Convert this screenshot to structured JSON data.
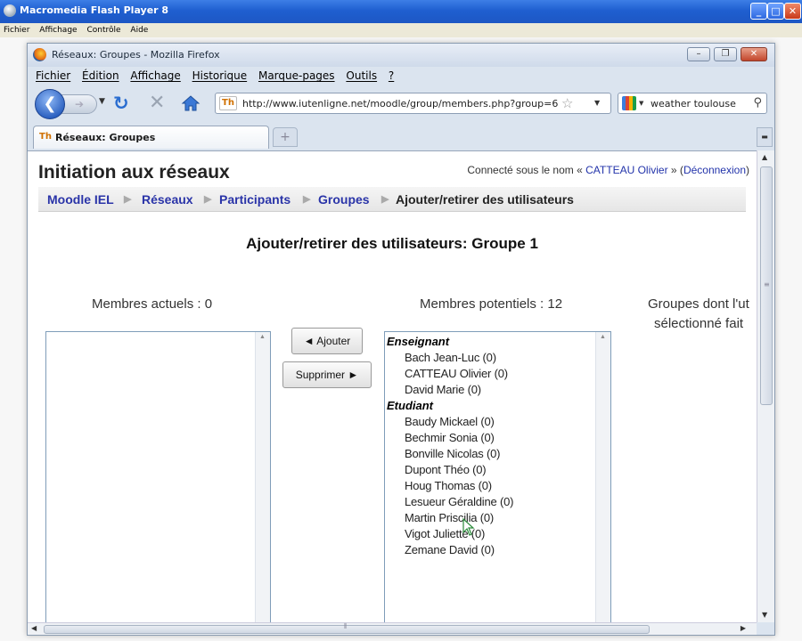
{
  "flash_player": {
    "title": "Macromedia Flash Player 8",
    "menu": [
      "Fichier",
      "Affichage",
      "Contrôle",
      "Aide"
    ]
  },
  "firefox": {
    "title": "Réseaux: Groupes - Mozilla Firefox",
    "menu": [
      "Fichier",
      "Édition",
      "Affichage",
      "Historique",
      "Marque-pages",
      "Outils",
      "?"
    ],
    "url": "http://www.iutenligne.net/moodle/group/members.php?group=6",
    "search_value": "weather toulouse",
    "tab_label": "Réseaux: Groupes",
    "tab_new": "+"
  },
  "page": {
    "course_title": "Initiation aux réseaux",
    "login_prefix": "Connecté sous le nom «",
    "login_user": "CATTEAU Olivier",
    "login_middle": "» (",
    "logout": "Déconnexion",
    "login_suffix": ")",
    "breadcrumb": [
      "Moodle IEL",
      "Réseaux",
      "Participants",
      "Groupes"
    ],
    "breadcrumb_current": "Ajouter/retirer des utilisateurs",
    "heading": "Ajouter/retirer des utilisateurs: Groupe 1",
    "current_members_label": "Membres actuels : 0",
    "potential_members_label": "Membres potentiels : 12",
    "groups_label_line1": "Groupes dont l'ut",
    "groups_label_line2": "sélectionné fait",
    "add_button": "◄ Ajouter",
    "remove_button": "Supprimer ►",
    "potential_members": [
      {
        "group": "Enseignant",
        "members": [
          "Bach Jean-Luc (0)",
          "CATTEAU Olivier (0)",
          "David Marie (0)"
        ]
      },
      {
        "group": "Etudiant",
        "members": [
          "Baudy Mickael (0)",
          "Bechmir Sonia (0)",
          "Bonville Nicolas (0)",
          "Dupont Théo (0)",
          "Houg Thomas (0)",
          "Lesueur Géraldine (0)",
          "Martin Priscilia (0)",
          "Vigot Juliette (0)",
          "Zemane David (0)"
        ]
      }
    ]
  }
}
